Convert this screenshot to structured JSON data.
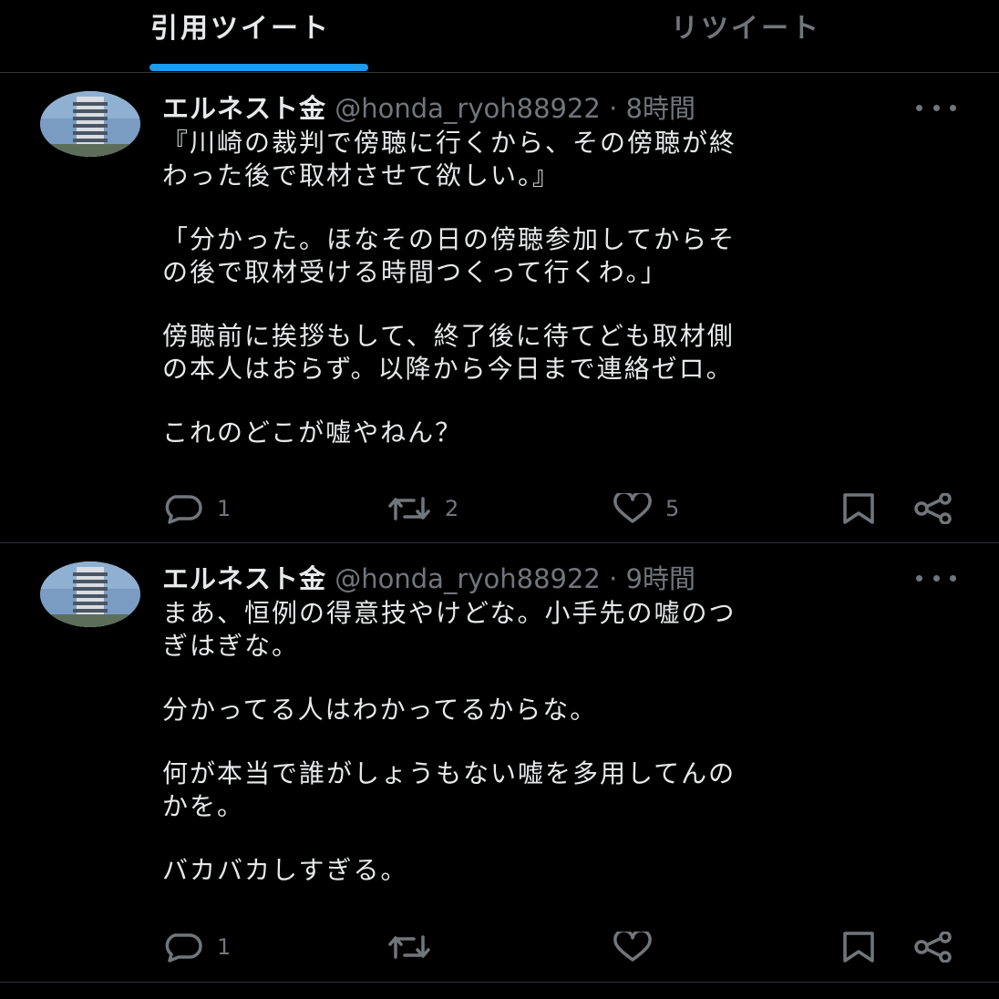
{
  "tabs": [
    {
      "label": "引用ツイート",
      "active": true
    },
    {
      "label": "リツイート",
      "active": false
    }
  ],
  "colors": {
    "accent": "#1d9bf0",
    "text": "#e7e9ea",
    "muted": "#71767b",
    "divider": "#2f3336",
    "background": "#000000"
  },
  "tweets": [
    {
      "name": "エルネスト金",
      "handle": "@honda_ryoh88922",
      "separator": "·",
      "time": "8時間",
      "paragraphs": [
        [
          "『川崎の裁判で傍聴に行くから、その傍聴が終",
          "わった後で取材させて欲しい。』"
        ],
        [
          "「分かった。ほなその日の傍聴参加してからそ",
          "の後で取材受ける時間つくって行くわ。」"
        ],
        [
          "傍聴前に挨拶もして、終了後に待てども取材側",
          "の本人はおらず。以降から今日まで連絡ゼロ。"
        ],
        [
          "これのどこが嘘やねん？"
        ]
      ],
      "reply_count": "1",
      "retweet_count": "2",
      "like_count": "5"
    },
    {
      "name": "エルネスト金",
      "handle": "@honda_ryoh88922",
      "separator": "·",
      "time": "9時間",
      "paragraphs": [
        [
          "まあ、恒例の得意技やけどな。小手先の嘘のつ",
          "ぎはぎな。"
        ],
        [
          "分かってる人はわかってるからな。"
        ],
        [
          "何が本当で誰がしょうもない嘘を多用してんの",
          "かを。"
        ],
        [
          "バカバカしすぎる。"
        ]
      ],
      "reply_count": "1",
      "retweet_count": "",
      "like_count": ""
    }
  ],
  "icons": {
    "reply": "reply-bubble-icon",
    "retweet": "retweet-arrows-icon",
    "like": "heart-icon",
    "bookmark": "bookmark-icon",
    "share": "share-nodes-icon",
    "more": "more-horizontal-icon",
    "avatar": "round-tower-building-photo"
  }
}
